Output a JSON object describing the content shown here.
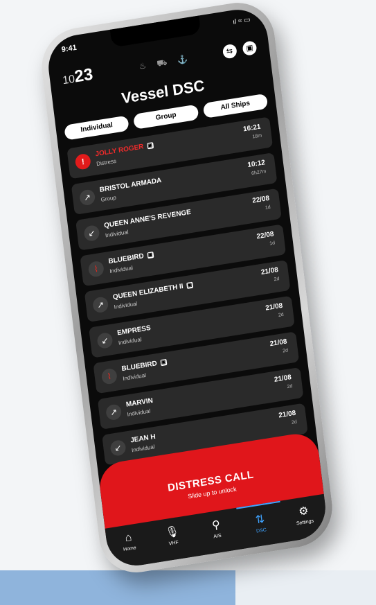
{
  "status": {
    "time": "9:41",
    "icons": "ıl ≈ ▭"
  },
  "header": {
    "channel_prefix": "10",
    "channel_number": "23",
    "mode_icons": "♨ ⛟ ⚓",
    "icon_button_1": "⇆",
    "icon_button_2": "▣",
    "title": "Vessel DSC"
  },
  "tabs": [
    "Individual",
    "Group",
    "All Ships"
  ],
  "calls": [
    {
      "name": "JOLLY ROGER",
      "tag": true,
      "type": "Distress",
      "time": "16:21",
      "ago": "18m",
      "icon": "!",
      "style": "alert"
    },
    {
      "name": "BRISTOL ARMADA",
      "tag": false,
      "type": "Group",
      "time": "10:12",
      "ago": "6h27m",
      "icon": "↗",
      "style": ""
    },
    {
      "name": "QUEEN ANNE'S REVENGE",
      "tag": false,
      "type": "Individual",
      "time": "22/08",
      "ago": "1d",
      "icon": "↙",
      "style": ""
    },
    {
      "name": "BLUEBIRD",
      "tag": true,
      "type": "Individual",
      "time": "22/08",
      "ago": "1d",
      "icon": "⌇",
      "style": "red"
    },
    {
      "name": "QUEEN ELIZABETH II",
      "tag": true,
      "type": "Individual",
      "time": "21/08",
      "ago": "2d",
      "icon": "↗",
      "style": ""
    },
    {
      "name": "EMPRESS",
      "tag": false,
      "type": "Individual",
      "time": "21/08",
      "ago": "2d",
      "icon": "↙",
      "style": ""
    },
    {
      "name": "BLUEBIRD",
      "tag": true,
      "type": "Individual",
      "time": "21/08",
      "ago": "2d",
      "icon": "⌇",
      "style": "red"
    },
    {
      "name": "MARVIN",
      "tag": false,
      "type": "Individual",
      "time": "21/08",
      "ago": "2d",
      "icon": "↗",
      "style": ""
    },
    {
      "name": "JEAN H",
      "tag": false,
      "type": "Individual",
      "time": "21/08",
      "ago": "2d",
      "icon": "↙",
      "style": ""
    }
  ],
  "distress": {
    "title": "DISTRESS CALL",
    "subtitle": "Slide up to unlock"
  },
  "nav": [
    {
      "label": "Home",
      "icon": "⌂",
      "active": false
    },
    {
      "label": "VHF",
      "icon": "🎙",
      "active": false
    },
    {
      "label": "AIS",
      "icon": "⚲",
      "active": false
    },
    {
      "label": "DSC",
      "icon": "⇅",
      "active": true
    },
    {
      "label": "Settings",
      "icon": "⚙",
      "active": false
    }
  ]
}
